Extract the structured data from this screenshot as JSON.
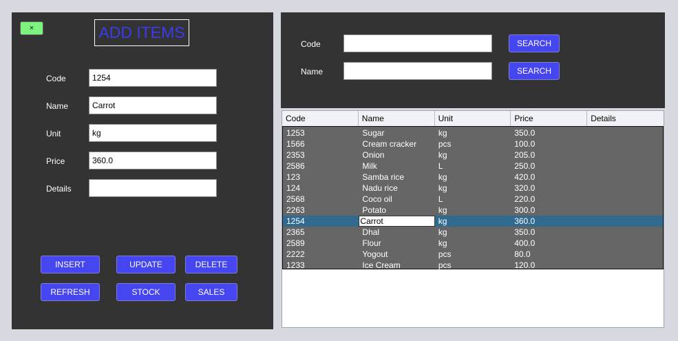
{
  "form": {
    "close_label": "×",
    "title": "ADD ITEMS",
    "fields": [
      {
        "label": "Code",
        "value": "1254"
      },
      {
        "label": "Name",
        "value": "Carrot"
      },
      {
        "label": "Unit",
        "value": "kg"
      },
      {
        "label": "Price",
        "value": "360.0"
      },
      {
        "label": "Details",
        "value": ""
      }
    ],
    "buttons": {
      "insert": "INSERT",
      "update": "UPDATE",
      "delete": "DELETE",
      "refresh": "REFRESH",
      "stock": "STOCK",
      "sales": "SALES"
    }
  },
  "search": {
    "code_label": "Code",
    "name_label": "Name",
    "code_value": "",
    "name_value": "",
    "button_label": "SEARCH"
  },
  "table": {
    "columns": [
      "Code",
      "Name",
      "Unit",
      "Price",
      "Details"
    ],
    "selected_index": 8,
    "rows": [
      {
        "code": "1253",
        "name": "Sugar",
        "unit": "kg",
        "price": "350.0",
        "details": ""
      },
      {
        "code": "1566",
        "name": "Cream cracker",
        "unit": "pcs",
        "price": "100.0",
        "details": ""
      },
      {
        "code": "2353",
        "name": "Onion",
        "unit": "kg",
        "price": "205.0",
        "details": ""
      },
      {
        "code": "2586",
        "name": "Milk",
        "unit": "L",
        "price": "250.0",
        "details": ""
      },
      {
        "code": "123",
        "name": "Samba rice",
        "unit": "kg",
        "price": "420.0",
        "details": ""
      },
      {
        "code": "124",
        "name": "Nadu rice",
        "unit": "kg",
        "price": "320.0",
        "details": ""
      },
      {
        "code": "2568",
        "name": "Coco oil",
        "unit": "L",
        "price": "220.0",
        "details": ""
      },
      {
        "code": "2263",
        "name": "Potato",
        "unit": "kg",
        "price": "300.0",
        "details": ""
      },
      {
        "code": "1254",
        "name": "Carrot",
        "unit": "kg",
        "price": "360.0",
        "details": ""
      },
      {
        "code": "2365",
        "name": "Dhal",
        "unit": "kg",
        "price": "350.0",
        "details": ""
      },
      {
        "code": "2589",
        "name": "Flour",
        "unit": "kg",
        "price": "400.0",
        "details": ""
      },
      {
        "code": "2222",
        "name": "Yogout",
        "unit": "pcs",
        "price": "80.0",
        "details": ""
      },
      {
        "code": "1233",
        "name": "Ice Cream",
        "unit": "pcs",
        "price": "120.0",
        "details": ""
      }
    ]
  },
  "colors": {
    "panel": "#333333",
    "accent_button": "#4646f0",
    "title_text": "#3b3bef",
    "close_button": "#7ef27e",
    "row_selected": "#316a8f",
    "table_body": "#666666"
  }
}
